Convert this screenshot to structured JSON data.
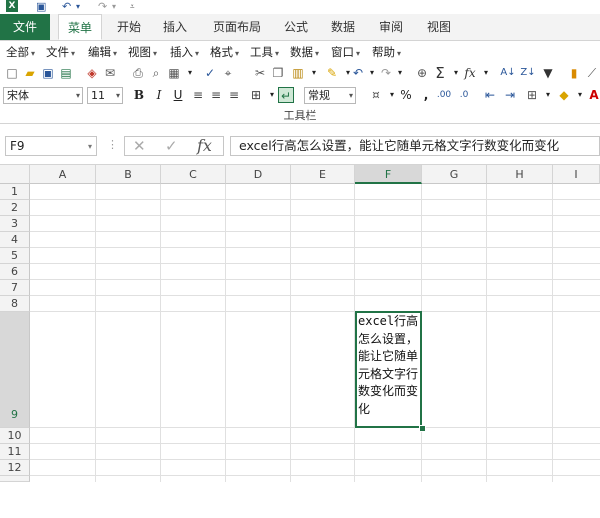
{
  "qat": {
    "app_icon": "excel-icon",
    "save_icon": "save-icon",
    "undo_icon": "undo-icon",
    "redo_icon": "redo-icon",
    "customize_icon": "customize-icon"
  },
  "tabs": [
    {
      "label": "文件"
    },
    {
      "label": "菜单"
    },
    {
      "label": "开始"
    },
    {
      "label": "插入"
    },
    {
      "label": "页面布局"
    },
    {
      "label": "公式"
    },
    {
      "label": "数据"
    },
    {
      "label": "审阅"
    },
    {
      "label": "视图"
    }
  ],
  "menu": [
    {
      "label": "全部"
    },
    {
      "label": "文件"
    },
    {
      "label": "编辑"
    },
    {
      "label": "视图"
    },
    {
      "label": "插入"
    },
    {
      "label": "格式"
    },
    {
      "label": "工具"
    },
    {
      "label": "数据"
    },
    {
      "label": "窗口"
    },
    {
      "label": "帮助"
    }
  ],
  "toolbar": {
    "font_name": "宋体",
    "font_size": "11",
    "bold": "B",
    "italic": "I",
    "underline": "U",
    "number_format": "常规",
    "percent": "%",
    "comma": ",",
    "caption": "工具栏"
  },
  "formula_bar": {
    "name_box": "F9",
    "formula": "excel行高怎么设置，能让它随单元格文字行数变化而变化"
  },
  "grid": {
    "columns": [
      "A",
      "B",
      "C",
      "D",
      "E",
      "F",
      "G",
      "H",
      "I"
    ],
    "rows": [
      "1",
      "2",
      "3",
      "4",
      "5",
      "6",
      "7",
      "8",
      "9",
      "10",
      "11",
      "12"
    ],
    "active_cell_text": "excel行高怎么设置，能让它随单元格文字行数变化而变化",
    "selected_column": "F",
    "selected_row": "9"
  },
  "colors": {
    "accent": "#217346"
  }
}
